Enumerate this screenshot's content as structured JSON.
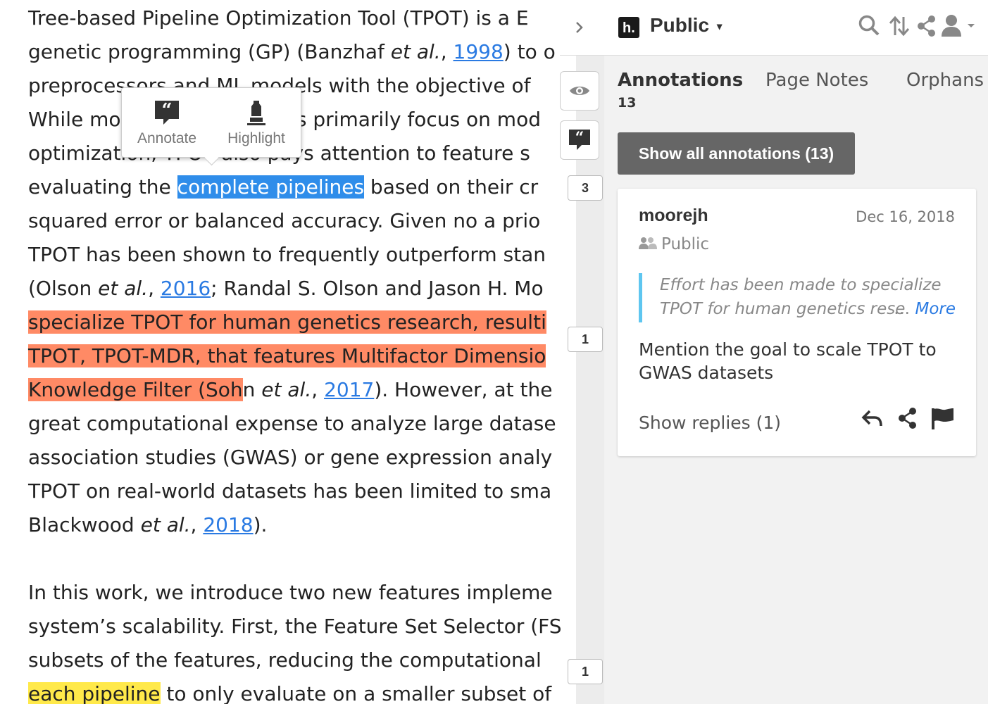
{
  "document": {
    "lines": [
      {
        "segments": [
          {
            "t": "Tree-based Pipeline Optimization Tool (TPOT) is a E"
          }
        ]
      },
      {
        "segments": [
          {
            "t": "genetic programming (GP) (Banzhaf "
          },
          {
            "t": "et al.",
            "s": "em"
          },
          {
            "t": ", "
          },
          {
            "t": "1998",
            "s": "cite"
          },
          {
            "t": ") to o"
          }
        ]
      },
      {
        "segments": [
          {
            "t": "preprocessors and ML models with the objective of"
          }
        ]
      },
      {
        "segments": [
          {
            "t": "While most AutoML systems primarily focus on mod"
          }
        ]
      },
      {
        "segments": [
          {
            "t": "optimization, TPOT also pays attention to feature s"
          }
        ]
      },
      {
        "segments": [
          {
            "t": "evaluating the "
          },
          {
            "t": "complete pipelines",
            "s": "sel"
          },
          {
            "t": " based on their cr"
          }
        ]
      },
      {
        "segments": [
          {
            "t": "squared error or balanced accuracy. Given no a prio"
          }
        ]
      },
      {
        "segments": [
          {
            "t": "TPOT has been shown to frequently outperform stan"
          }
        ]
      },
      {
        "segments": [
          {
            "t": "(Olson "
          },
          {
            "t": "et al.",
            "s": "em"
          },
          {
            "t": ", "
          },
          {
            "t": "2016",
            "s": "cite"
          },
          {
            "t": "; Randal S. Olson and Jason H. Mo"
          }
        ]
      },
      {
        "segments": [
          {
            "t": "specialize TPOT for human genetics research, resulti",
            "s": "orange"
          }
        ]
      },
      {
        "segments": [
          {
            "t": "TPOT, TPOT-MDR, that features Multifactor Dimensio",
            "s": "orange"
          }
        ]
      },
      {
        "segments": [
          {
            "t": "Knowledge Filter (Soh",
            "s": "orange"
          },
          {
            "t": "n "
          },
          {
            "t": "et al.",
            "s": "em"
          },
          {
            "t": ", "
          },
          {
            "t": "2017",
            "s": "cite"
          },
          {
            "t": "). However, at the"
          }
        ]
      },
      {
        "segments": [
          {
            "t": "great computational expense to analyze large datase"
          }
        ]
      },
      {
        "segments": [
          {
            "t": "association studies (GWAS) or gene expression analy"
          }
        ]
      },
      {
        "segments": [
          {
            "t": "TPOT on real-world datasets has been limited to sma"
          }
        ]
      },
      {
        "segments": [
          {
            "t": "Blackwood "
          },
          {
            "t": "et al.",
            "s": "em"
          },
          {
            "t": ", "
          },
          {
            "t": "2018",
            "s": "cite"
          },
          {
            "t": ")."
          }
        ]
      },
      {
        "segments": [
          {
            "t": ""
          }
        ]
      },
      {
        "segments": [
          {
            "t": "In this work, we introduce two new features impleme"
          }
        ]
      },
      {
        "segments": [
          {
            "t": "system’s scalability. First, the Feature Set Selector (FS"
          }
        ]
      },
      {
        "segments": [
          {
            "t": "subsets of the features, reducing the computational"
          }
        ]
      },
      {
        "segments": [
          {
            "t": "each pipeline",
            "s": "yellow"
          },
          {
            "t": " to only evaluate on a smaller subset of"
          }
        ]
      }
    ]
  },
  "adder": {
    "annotate_label": "Annotate",
    "highlight_label": "Highlight"
  },
  "buckets": [
    "3",
    "1",
    "1"
  ],
  "header": {
    "group": "Public"
  },
  "tabs": {
    "annotations": "Annotations",
    "annotations_count": "13",
    "page_notes": "Page Notes",
    "orphans": "Orphans"
  },
  "show_all_label": "Show all annotations (13)",
  "annotation": {
    "author": "moorejh",
    "date": "Dec 16, 2018",
    "privacy": "Public",
    "quote": "Effort has been made to specialize TPOT for human genetics rese",
    "more_label": "More",
    "body": "Mention the goal to scale TPOT to GWAS datasets",
    "replies_label": "Show replies (1)"
  }
}
